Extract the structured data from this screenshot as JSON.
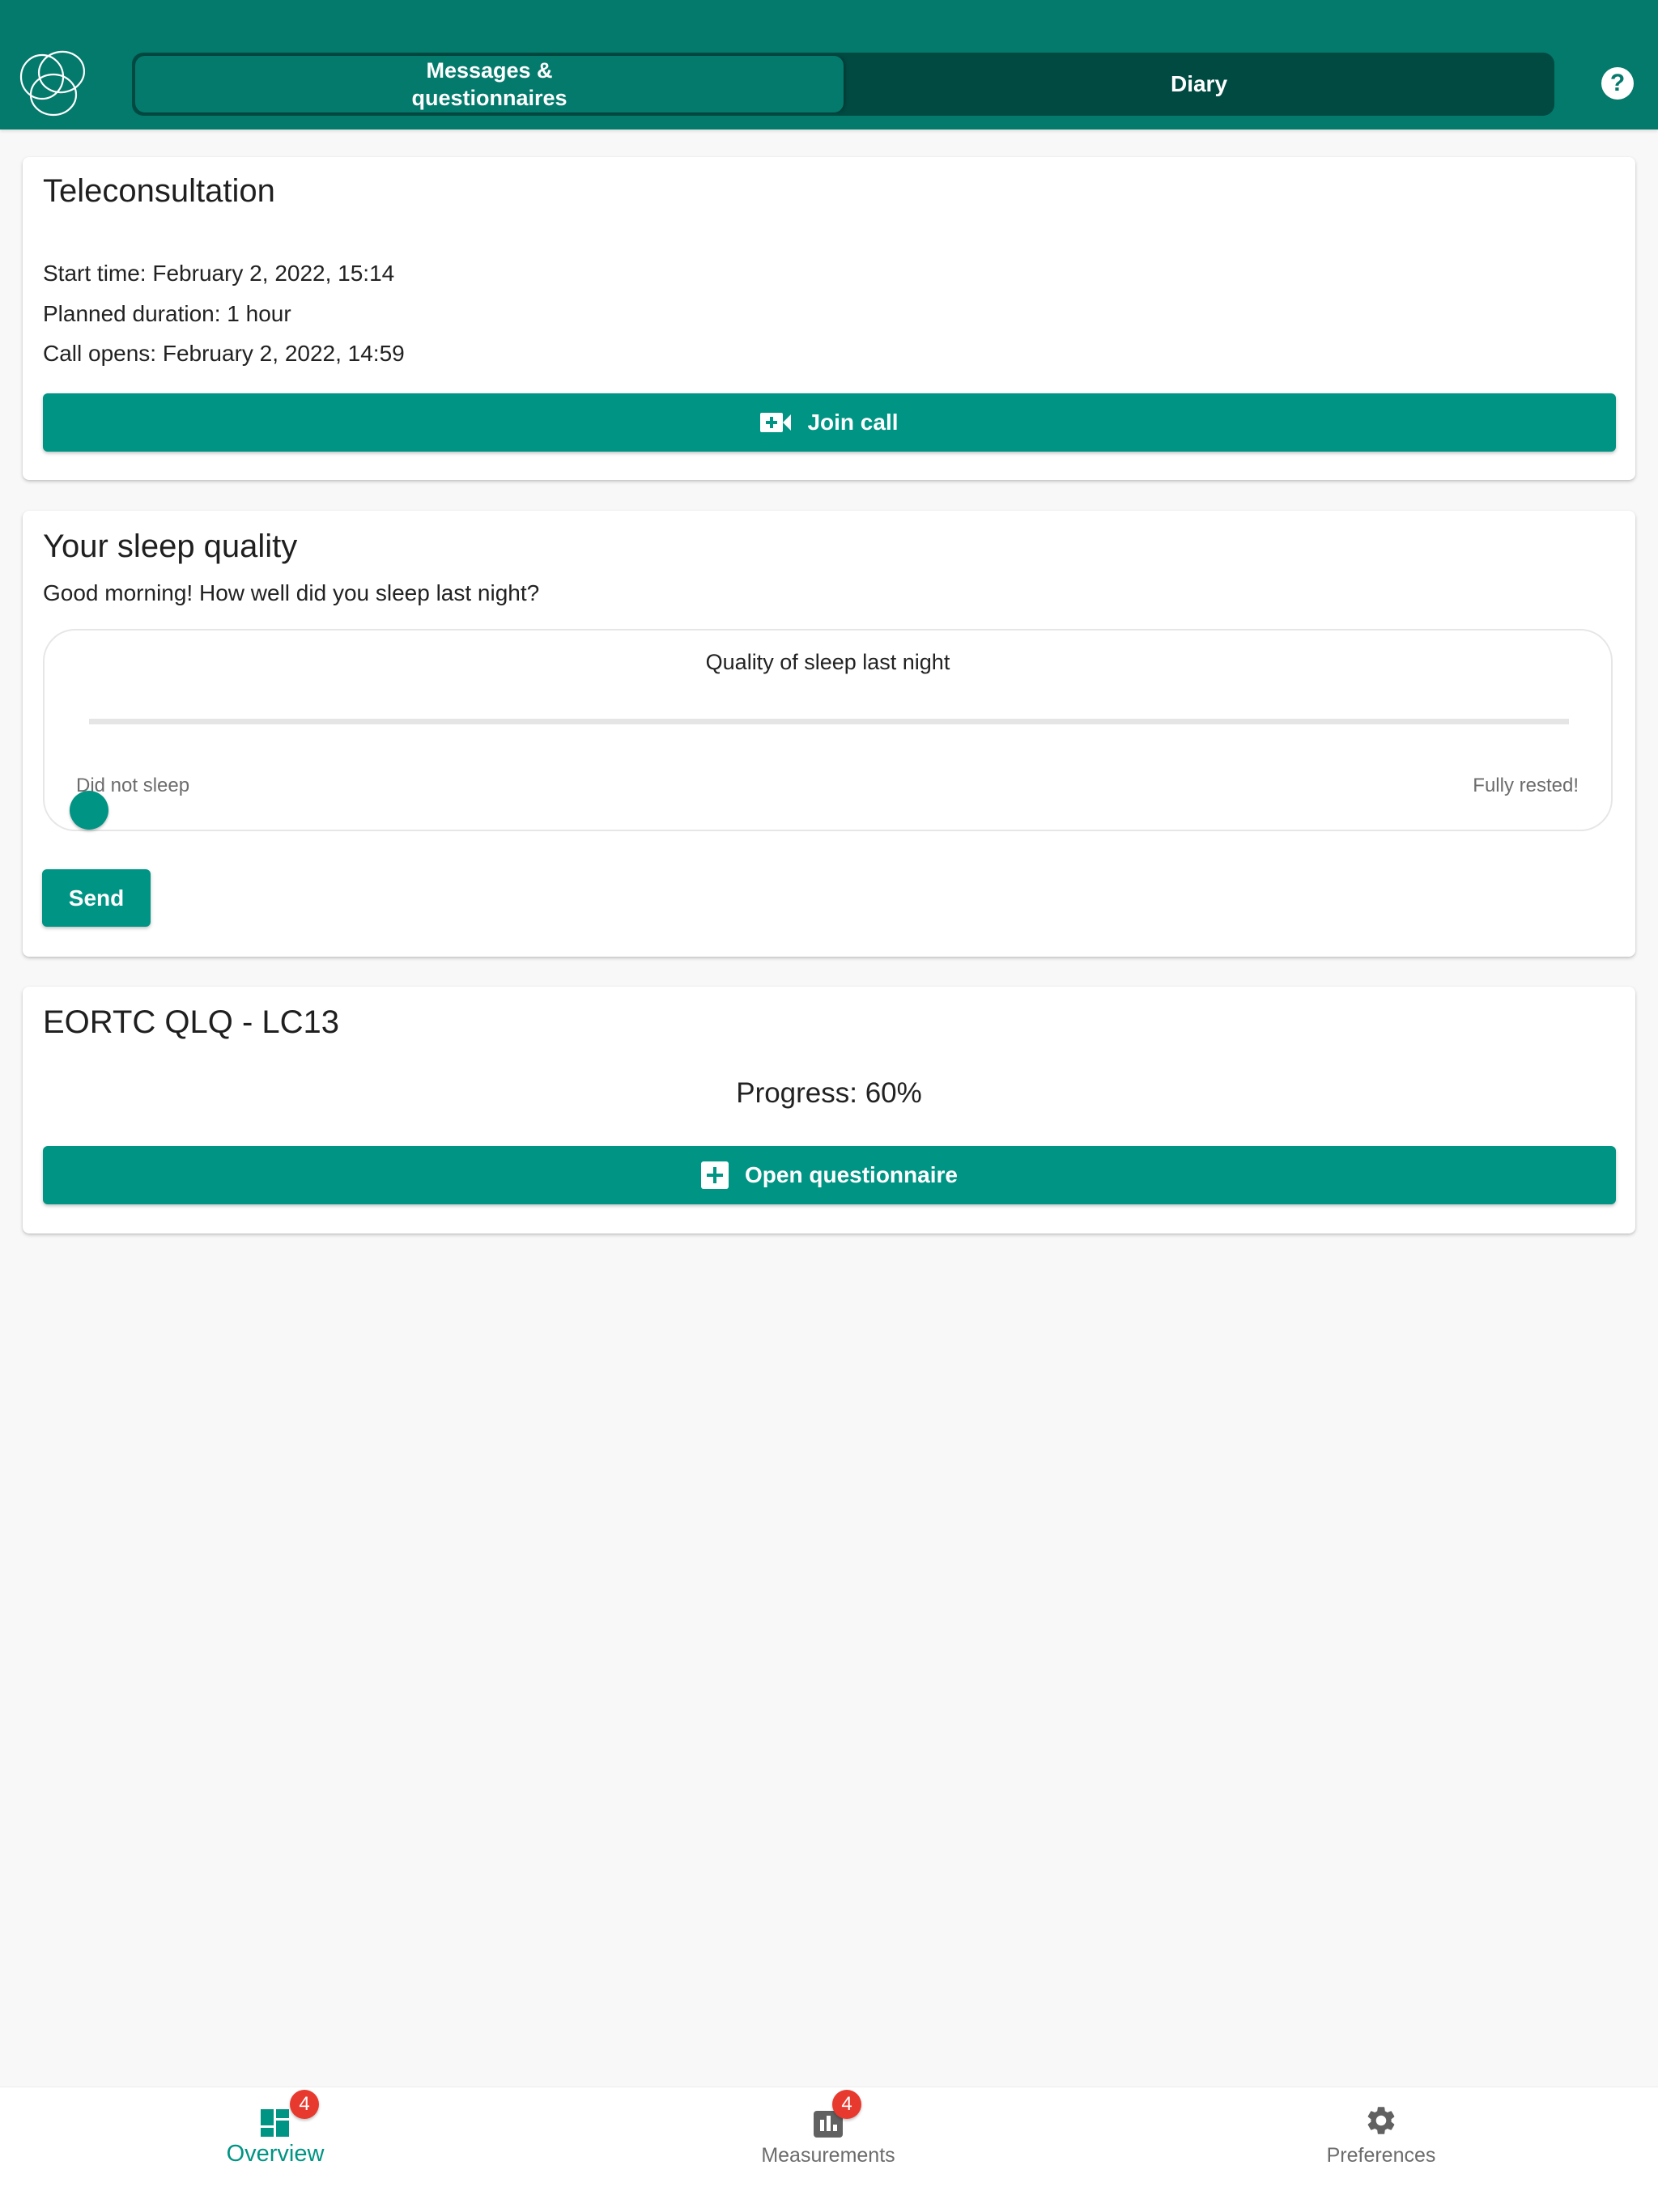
{
  "header": {
    "tabs": [
      {
        "label": "Messages & questionnaires",
        "active": true
      },
      {
        "label": "Diary",
        "active": false
      }
    ],
    "help_icon": "question-circle-icon",
    "logo_icon": "overlapping-circles-logo"
  },
  "teleconsultation": {
    "title": "Teleconsultation",
    "start_time": "Start time: February 2, 2022, 15:14",
    "planned_duration": "Planned duration: 1 hour",
    "call_opens": "Call opens: February 2, 2022, 14:59",
    "join_button": {
      "label": "Join call",
      "icon": "video-plus-icon"
    }
  },
  "sleep_quality": {
    "title": "Your sleep quality",
    "prompt": "Good morning! How well did you sleep last night?",
    "slider": {
      "label": "Quality of sleep last night",
      "min_label": "Did not sleep",
      "max_label": "Fully rested!",
      "value_fraction": 0
    },
    "send_label": "Send"
  },
  "questionnaire": {
    "title": "EORTC QLQ - LC13",
    "progress_text": "Progress: 60%",
    "progress_percent": 60,
    "open_button": {
      "label": "Open questionnaire",
      "icon": "plus-square-icon"
    }
  },
  "bottom_nav": {
    "items": [
      {
        "label": "Overview",
        "icon": "dashboard-icon",
        "badge": "4",
        "active": true
      },
      {
        "label": "Measurements",
        "icon": "bar-chart-icon",
        "badge": "4",
        "active": false
      },
      {
        "label": "Preferences",
        "icon": "gear-icon",
        "badge": null,
        "active": false
      }
    ]
  },
  "colors": {
    "header": "#047a6c",
    "tab_track": "#004a42",
    "primary": "#009484",
    "badge": "#e8392f",
    "background": "#f8f8f8"
  }
}
